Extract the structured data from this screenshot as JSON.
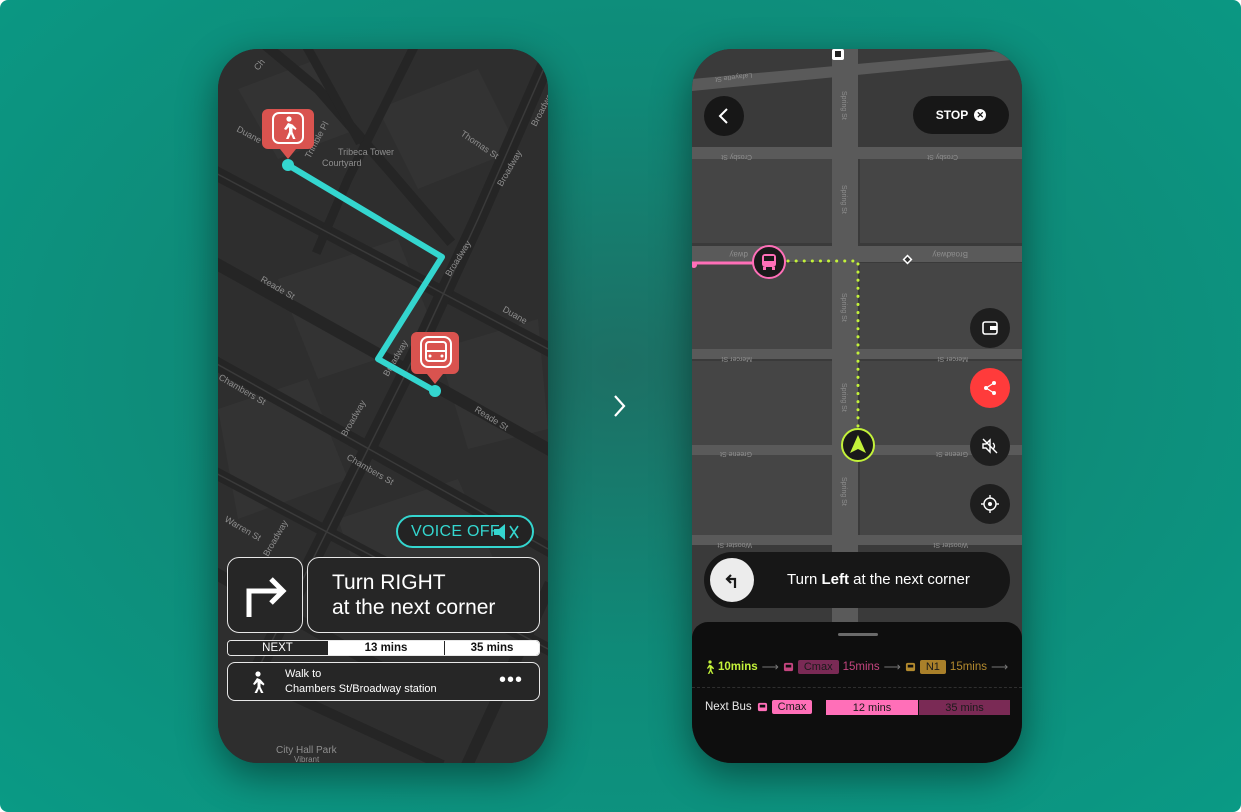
{
  "colors": {
    "background": "#0a9a85",
    "route_cyan": "#34d6cf",
    "marker_red": "#d9534f",
    "lime": "#c3f23a",
    "pink": "#ff6fb8",
    "share_red": "#ff3b3b"
  },
  "left_screen": {
    "map_labels": {
      "duane_st": "Duane St",
      "trimble_pl": "Trimble Pl",
      "thomas_st": "Thomas St",
      "tribeca_tower_1": "Tribeca Tower",
      "tribeca_tower_2": "Courtyard",
      "broadway_1": "Broadway",
      "broadway_2": "Broadway",
      "broadway_3": "Broadway",
      "broadway_4": "Broadway",
      "broadway_5": "Broadway",
      "duane_st_2": "Duane",
      "reade_st_1": "Reade St",
      "reade_st_2": "Reade St",
      "chambers_st_1": "Chambers St",
      "chambers_st_2": "Chambers St",
      "warren_st": "Warren St",
      "city_hall_park": "City Hall Park",
      "vibrant": "Vibrant",
      "ch_top": "Ch"
    },
    "voice_button": {
      "label": "VOICE OFF",
      "icon": "speaker-muted-icon"
    },
    "instruction": {
      "line1": "Turn RIGHT",
      "line2": "at the next corner",
      "icon": "turn-right-arrow-icon"
    },
    "next_bar": {
      "label": "NEXT",
      "time1": "13 mins",
      "time2": "35 mins"
    },
    "walk": {
      "line1": "Walk to",
      "line2": "Chambers St/Broadway station",
      "more": "•••",
      "icon": "walking-person-icon"
    }
  },
  "right_screen": {
    "stop_label": "STOP",
    "map_labels": {
      "lafayette": "Lafayette St",
      "crosby_1": "Crosby St",
      "crosby_2": "Crosby St",
      "broadway": "Broadway",
      "broadway_left": "dway",
      "mercer_1": "Mercer St",
      "mercer_2": "Mercer St",
      "greene_1": "Greene St",
      "greene_2": "Greene St",
      "wooster_1": "Wooster St",
      "wooster_2": "Wooster St",
      "spring_1": "Spring St",
      "spring_2": "Spring St",
      "spring_3": "Spring St",
      "spring_4": "Spring St",
      "spring_5": "Spring St"
    },
    "instruction": {
      "prefix": "Turn ",
      "bold": "Left",
      "suffix": " at the next corner",
      "icon": "turn-left-arrow-icon"
    },
    "route": {
      "walk_time": "10mins",
      "bus1_tag": "Cmax",
      "bus1_time": "15mins",
      "bus2_tag": "N1",
      "bus2_time": "15mins"
    },
    "next_bus": {
      "label": "Next Bus",
      "tag": "Cmax",
      "time1": "12 mins",
      "time2": "35 mins"
    }
  }
}
